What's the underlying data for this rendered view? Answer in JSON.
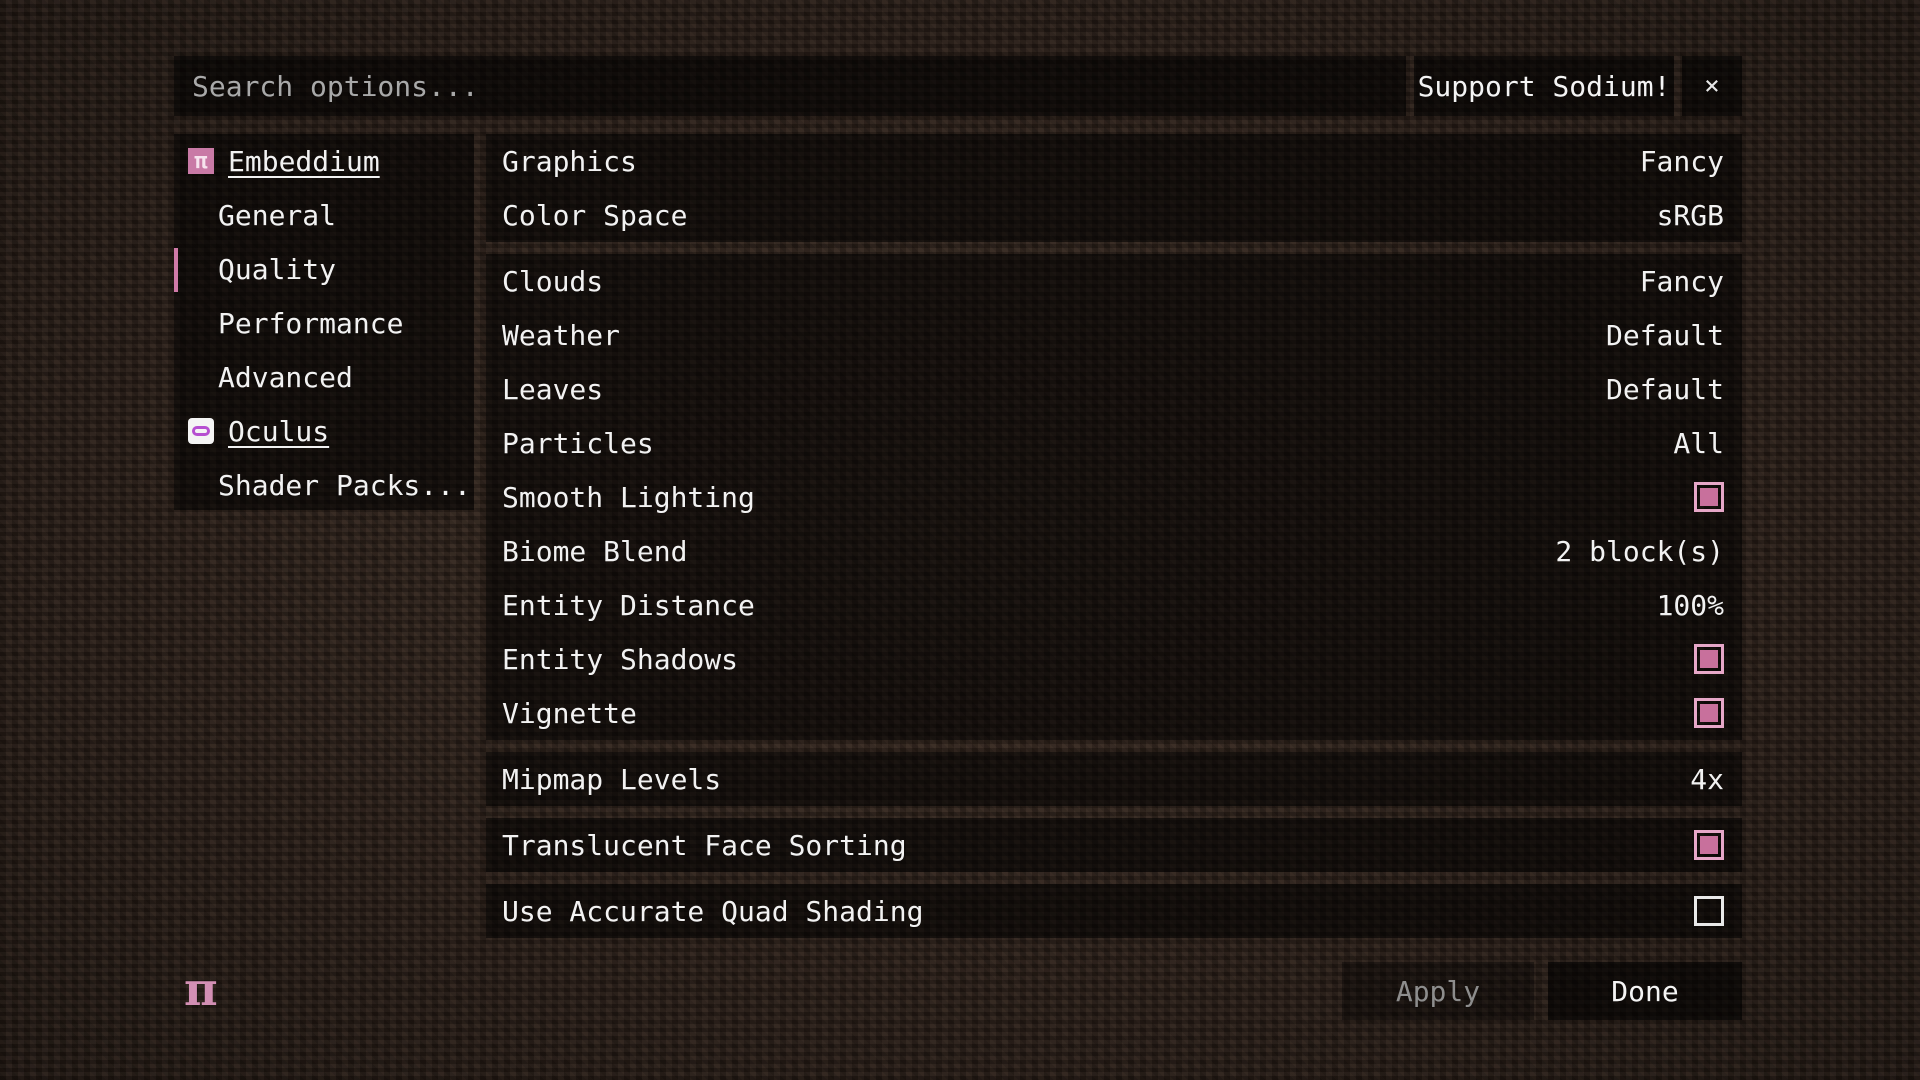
{
  "search": {
    "placeholder": "Search options..."
  },
  "header": {
    "support_label": "Support Sodium!",
    "close_label": "×"
  },
  "sidebar": {
    "items": [
      {
        "label": "Embeddium",
        "type": "mod",
        "icon": "embeddium-pi-icon"
      },
      {
        "label": "General",
        "type": "page"
      },
      {
        "label": "Quality",
        "type": "page",
        "active": true
      },
      {
        "label": "Performance",
        "type": "page"
      },
      {
        "label": "Advanced",
        "type": "page"
      },
      {
        "label": "Oculus",
        "type": "mod",
        "icon": "oculus-eye-icon"
      },
      {
        "label": "Shader Packs...",
        "type": "page"
      }
    ]
  },
  "options": {
    "group1": [
      {
        "name": "Graphics",
        "value": "Fancy"
      },
      {
        "name": "Color Space",
        "value": "sRGB"
      }
    ],
    "group2": [
      {
        "name": "Clouds",
        "value": "Fancy"
      },
      {
        "name": "Weather",
        "value": "Default"
      },
      {
        "name": "Leaves",
        "value": "Default"
      },
      {
        "name": "Particles",
        "value": "All"
      },
      {
        "name": "Smooth Lighting",
        "checked": true
      },
      {
        "name": "Biome Blend",
        "value": "2 block(s)"
      },
      {
        "name": "Entity Distance",
        "value": "100%"
      },
      {
        "name": "Entity Shadows",
        "checked": true
      },
      {
        "name": "Vignette",
        "checked": true
      }
    ],
    "group3": [
      {
        "name": "Mipmap Levels",
        "value": "4x"
      }
    ],
    "group4": [
      {
        "name": "Translucent Face Sorting",
        "checked": true
      }
    ],
    "group5": [
      {
        "name": "Use Accurate Quad Shading",
        "checked": false
      }
    ]
  },
  "footer": {
    "logo": "π",
    "apply_label": "Apply",
    "done_label": "Done"
  },
  "colors": {
    "accent": "#c8709c",
    "accent_border": "#e6a7c8"
  }
}
